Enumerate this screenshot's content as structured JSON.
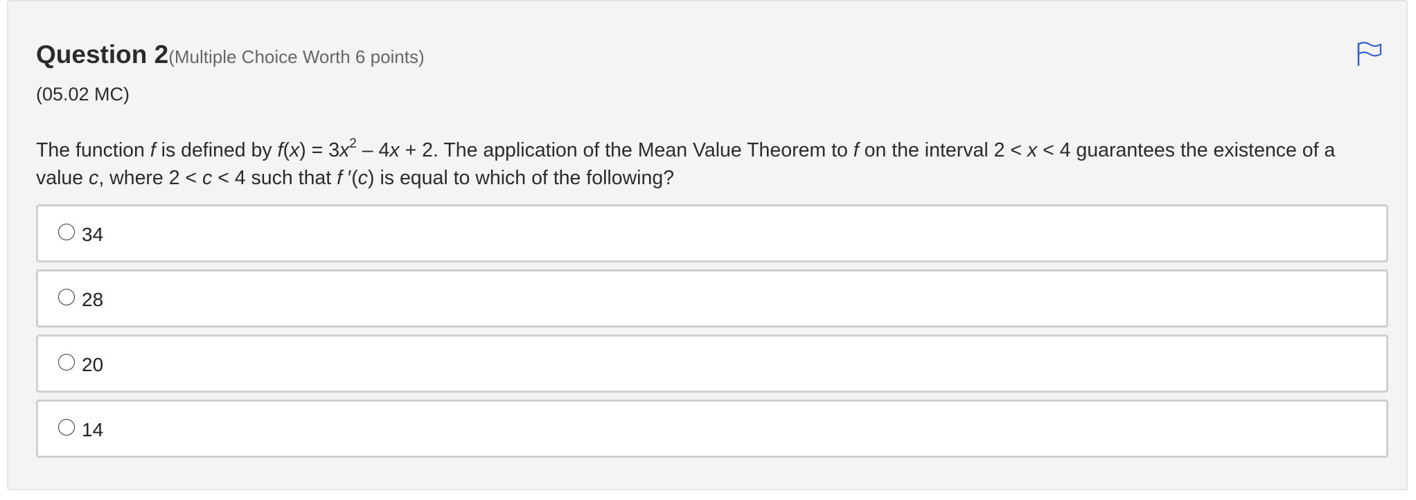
{
  "question": {
    "title": "Question 2",
    "meta": "(Multiple Choice Worth 6 points)",
    "code": "(05.02 MC)",
    "flag_icon": "flag-icon",
    "flag_color": "#2f5fd0",
    "stem": {
      "t1": "The function ",
      "f1": "f",
      "t2": " is defined by ",
      "f2": "f",
      "t3": "(",
      "x1": "x",
      "t4": ") = 3",
      "x2": "x",
      "exp": "2",
      "t5": " – 4",
      "x3": "x",
      "t6": " + 2. The application of the Mean Value Theorem to ",
      "f3": "f",
      "t7": " on the interval 2 < ",
      "x4": "x",
      "t8": " < 4 guarantees the existence of a value ",
      "c1": "c",
      "t9": ", where 2 < ",
      "c2": "c",
      "t10": " < 4 such that ",
      "f4": "f",
      "t11": " ′(",
      "c3": "c",
      "t12": ") is equal to which of the following?"
    }
  },
  "options": [
    {
      "label": "34"
    },
    {
      "label": "28"
    },
    {
      "label": "20"
    },
    {
      "label": "14"
    }
  ]
}
